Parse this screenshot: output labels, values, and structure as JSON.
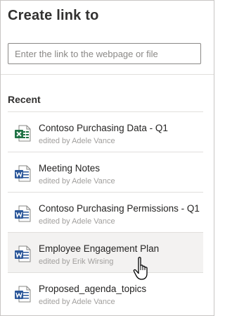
{
  "panel": {
    "title": "Create link to",
    "input": {
      "value": "",
      "placeholder": "Enter the link to the webpage or file"
    },
    "section_label": "Recent"
  },
  "recent_items": [
    {
      "name": "Contoso Purchasing Data - Q1",
      "editor": "edited by Adele Vance",
      "icon": "excel-file-icon",
      "hover": false
    },
    {
      "name": "Meeting Notes",
      "editor": "edited by Adele Vance",
      "icon": "word-file-icon",
      "hover": false
    },
    {
      "name": "Contoso Purchasing Permissions - Q1",
      "editor": "edited by Adele Vance",
      "icon": "word-file-icon",
      "hover": false
    },
    {
      "name": "Employee Engagement Plan",
      "editor": "edited by Erik Wirsing",
      "icon": "word-file-icon",
      "hover": true
    },
    {
      "name": "Proposed_agenda_topics",
      "editor": "edited by Adele Vance",
      "icon": "word-file-icon",
      "hover": false
    }
  ],
  "colors": {
    "excel_green": "#217346",
    "word_blue": "#2b579a",
    "hover_bg": "#f3f2f1"
  },
  "cursor": "hand-pointer-cursor-icon"
}
